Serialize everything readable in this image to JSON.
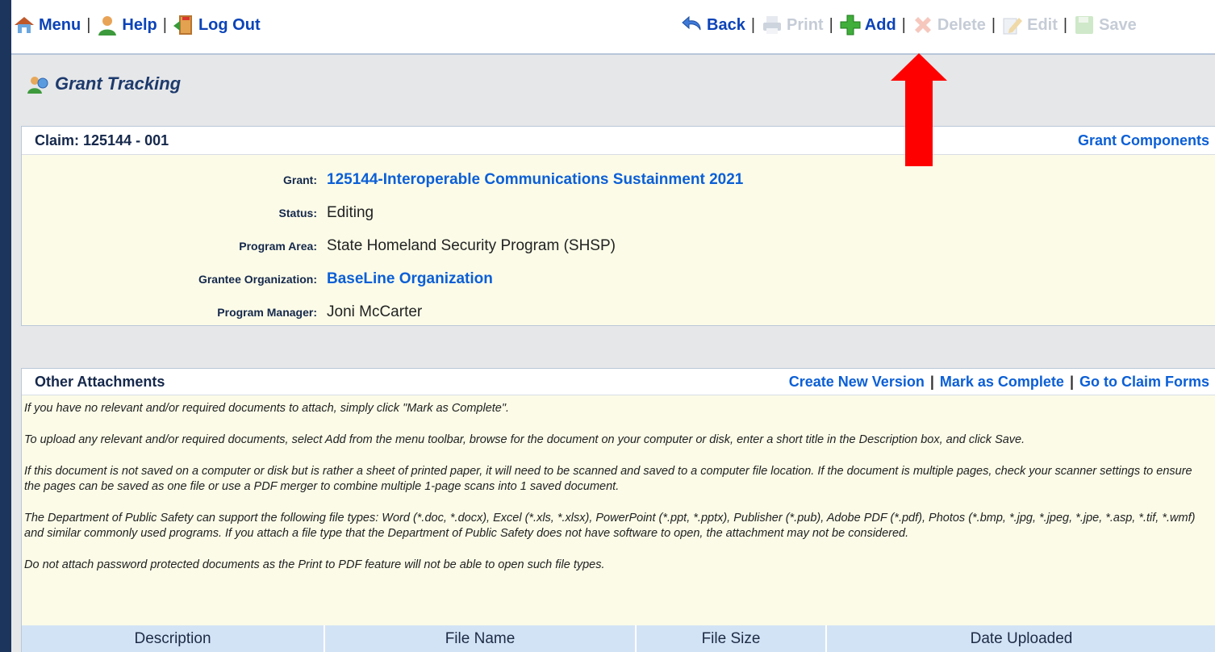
{
  "toolbar": {
    "menu": "Menu",
    "help": "Help",
    "logout": "Log Out",
    "back": "Back",
    "print": "Print",
    "add": "Add",
    "delete": "Delete",
    "edit": "Edit",
    "save": "Save",
    "separator": "|"
  },
  "page": {
    "title": "Grant Tracking"
  },
  "claim": {
    "header": "Claim: 125144 - 001",
    "components_link": "Grant Components",
    "fields": [
      {
        "label": "Grant:",
        "value": "125144-Interoperable Communications Sustainment 2021"
      },
      {
        "label": "Status:",
        "value": "Editing"
      },
      {
        "label": "Program Area:",
        "value": "State Homeland Security Program (SHSP)"
      },
      {
        "label": "Grantee Organization:",
        "value": "BaseLine Organization"
      },
      {
        "label": "Program Manager:",
        "value": "Joni McCarter"
      }
    ]
  },
  "attachments": {
    "header": "Other Attachments",
    "links": {
      "create_version": "Create New Version",
      "mark_complete": "Mark as Complete",
      "go_to_forms": "Go to Claim Forms"
    },
    "notes": [
      "If you have no relevant and/or required documents to attach, simply click \"Mark as Complete\".",
      "To upload any relevant and/or required documents, select Add from the menu toolbar, browse for the document on your computer or disk, enter a short title in the Description box, and click Save.",
      "If this document is not saved on a computer or disk but is rather a sheet of printed paper, it will need to be scanned and saved to a computer file location. If the document is multiple pages, check your scanner settings to ensure the pages can be saved as one file or use a PDF merger to combine multiple 1-page scans into 1 saved document.",
      "The Department of Public Safety can support the following file types: Word (*.doc, *.docx), Excel (*.xls, *.xlsx), PowerPoint (*.ppt, *.pptx), Publisher (*.pub), Adobe PDF (*.pdf), Photos (*.bmp, *.jpg, *.jpeg, *.jpe, *.asp, *.tif, *.wmf) and similar commonly used programs. If you attach a file type that the Department of Public Safety does not have software to open, the attachment may not be considered.",
      "Do not attach password protected documents as the Print to PDF feature will not be able to open such file types."
    ],
    "columns": [
      "Description",
      "File Name",
      "File Size",
      "Date Uploaded"
    ]
  },
  "colors": {
    "link": "#0b5fd6",
    "toolbar_link": "#0b43b8",
    "panel_bg": "#fbfbe8",
    "table_header_bg": "#d3e3f6",
    "annotation_arrow": "#ff0000"
  }
}
